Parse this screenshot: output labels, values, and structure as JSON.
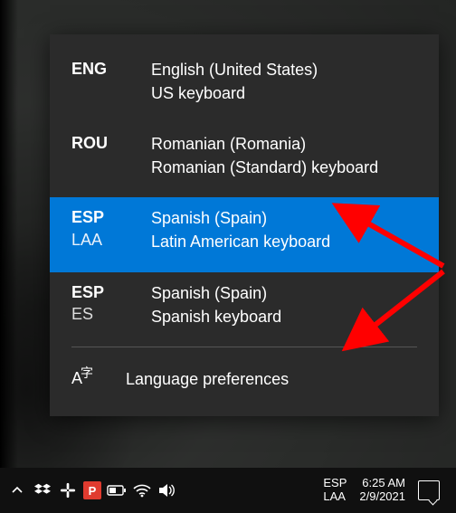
{
  "languages": [
    {
      "abbr1": "ENG",
      "abbr2": "",
      "line1": "English (United States)",
      "line2": "US keyboard",
      "selected": false
    },
    {
      "abbr1": "ROU",
      "abbr2": "",
      "line1": "Romanian (Romania)",
      "line2": "Romanian (Standard) keyboard",
      "selected": false
    },
    {
      "abbr1": "ESP",
      "abbr2": "LAA",
      "line1": "Spanish (Spain)",
      "line2": "Latin American keyboard",
      "selected": true
    },
    {
      "abbr1": "ESP",
      "abbr2": "ES",
      "line1": "Spanish (Spain)",
      "line2": "Spanish keyboard",
      "selected": false
    }
  ],
  "prefs_label": "Language preferences",
  "taskbar": {
    "lang_abbr1": "ESP",
    "lang_abbr2": "LAA",
    "time": "6:25 AM",
    "date": "2/9/2021"
  },
  "icons": {
    "chevron": "chevron-up-icon",
    "dropbox": "dropbox-icon",
    "slack": "slack-icon",
    "polaris": "polaris-office-icon",
    "battery": "battery-icon",
    "wifi": "wifi-icon",
    "volume": "volume-icon",
    "notifications": "action-center-icon",
    "lang_pref": "language-glyph-icon"
  },
  "accent": "#0078d7",
  "annotation_color": "#ff0000"
}
